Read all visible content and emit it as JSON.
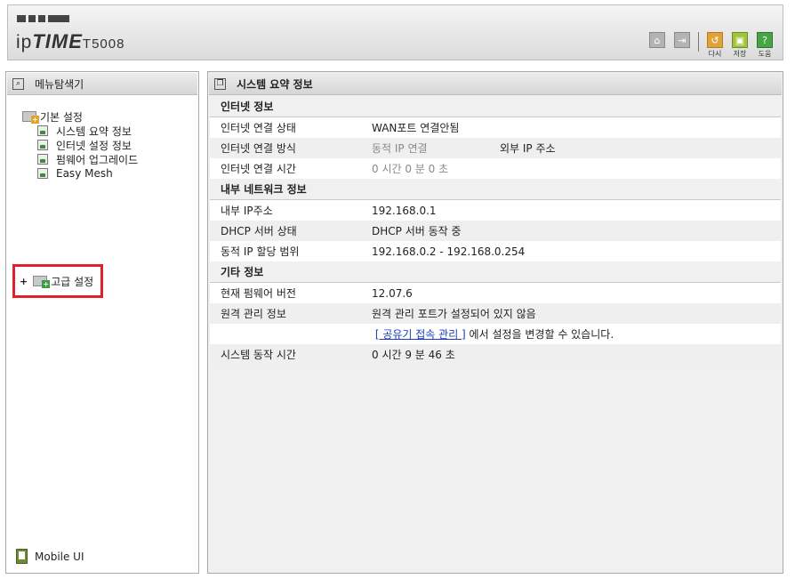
{
  "header": {
    "logo": {
      "prefix": "ip",
      "brand": "TIME",
      "model": "T5008"
    },
    "toolbar": [
      {
        "icon": "home-icon",
        "label": ""
      },
      {
        "icon": "logout-icon",
        "label": ""
      },
      {
        "icon": "undo-icon",
        "label": "다시"
      },
      {
        "icon": "save-icon",
        "label": "저장"
      },
      {
        "icon": "help-icon",
        "label": "도움"
      }
    ]
  },
  "sidebar": {
    "title": "메뉴탐색기",
    "groups": [
      {
        "label": "기본 설정",
        "items": [
          {
            "label": "시스템 요약 정보"
          },
          {
            "label": "인터넷 설정 정보"
          },
          {
            "label": "펌웨어 업그레이드"
          },
          {
            "label": "Easy Mesh"
          }
        ]
      },
      {
        "label": "고급 설정",
        "expander": "+"
      }
    ],
    "mobile_label": "Mobile UI"
  },
  "main": {
    "title": "시스템 요약 정보",
    "sections": [
      {
        "title": "인터넷 정보",
        "rows": [
          {
            "key": "인터넷 연결 상태",
            "value": "WAN포트 연결안됨"
          },
          {
            "key": "인터넷 연결 방식",
            "value": "동적 IP 연결",
            "extra": "외부 IP 주소"
          },
          {
            "key": "인터넷 연결 시간",
            "value": "0 시간 0 분 0 초"
          }
        ]
      },
      {
        "title": "내부 네트워크 정보",
        "rows": [
          {
            "key": "내부 IP주소",
            "value": "192.168.0.1"
          },
          {
            "key": "DHCP 서버 상태",
            "value": "DHCP 서버 동작 중"
          },
          {
            "key": "동적 IP 할당 범위",
            "value": "192.168.0.2 -  192.168.0.254"
          }
        ]
      },
      {
        "title": "기타 정보",
        "rows": [
          {
            "key": "현재 펌웨어 버전",
            "value": "12.07.6"
          },
          {
            "key": "원격 관리 정보",
            "value": "원격 관리 포트가 설정되어 있지 않음"
          },
          {
            "key": "",
            "link": "[ 공유기 접속 관리 ]",
            "value": " 에서 설정을 변경할 수 있습니다."
          },
          {
            "key": "시스템 동작 시간",
            "value": "0 시간 9 분 46 초"
          }
        ]
      }
    ]
  }
}
